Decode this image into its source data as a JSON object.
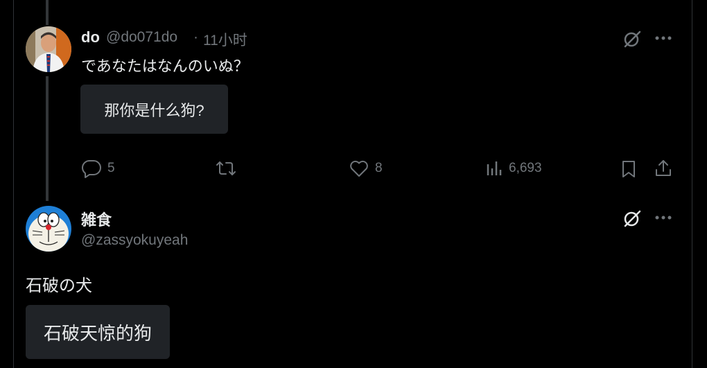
{
  "tweet1": {
    "name": "do",
    "handle": "@do071do",
    "separator": "·",
    "time": "11小时",
    "text": "であなたはなんのいぬ？",
    "translation": "那你是什么狗?",
    "actions": {
      "replies": "5",
      "retweets": "",
      "likes": "8",
      "views": "6,693"
    }
  },
  "tweet2": {
    "name": "雑食",
    "handle": "@zassyokuyeah",
    "text": "石破の犬",
    "translation": "石破天惊的狗"
  },
  "icons": {
    "grok": "grok-icon",
    "more": "more-icon",
    "reply": "reply-icon",
    "retweet": "retweet-icon",
    "like": "heart-icon",
    "views": "views-icon",
    "bookmark": "bookmark-icon",
    "share": "share-icon"
  },
  "colors": {
    "background": "#000000",
    "text": "#e7e9ea",
    "muted": "#71767b",
    "translation_box": "#202327",
    "thread_line": "#333639"
  }
}
